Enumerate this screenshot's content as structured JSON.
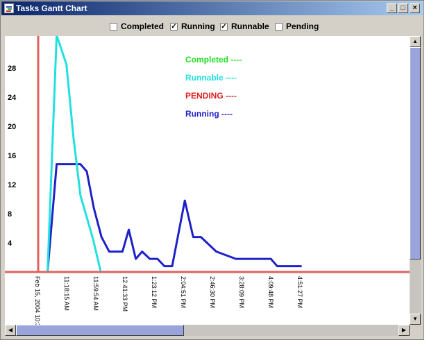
{
  "window": {
    "title": "Tasks Gantt Chart",
    "minimize_glyph": "_",
    "maximize_glyph": "□",
    "close_glyph": "×"
  },
  "legend_bar": {
    "checkboxes": [
      {
        "label": "Completed",
        "checked": false
      },
      {
        "label": "Running",
        "checked": true
      },
      {
        "label": "Runnable",
        "checked": true
      },
      {
        "label": "Pending",
        "checked": false
      }
    ]
  },
  "chart_data": {
    "type": "line",
    "title": "",
    "xlabel": "",
    "ylabel": "",
    "ylim": [
      0,
      32
    ],
    "y_ticks": [
      4,
      8,
      12,
      16,
      20,
      24,
      28
    ],
    "x_tick_labels": [
      "Feb 15, 2004 10:3",
      "11:18:15 AM",
      "11:59:54 AM",
      "12:41:33 PM",
      "1:23:12 PM",
      "2:04:51 PM",
      "2:46:30 PM",
      "3:28:09 PM",
      "4:09:48 PM",
      "4:51:27 PM"
    ],
    "x_tick_minutes": [
      36.6,
      78.25,
      119.9,
      161.55,
      203.2,
      244.85,
      286.5,
      328.15,
      369.8,
      411.45
    ],
    "legend_labels": [
      {
        "text": "Completed ----",
        "color": "#22dd22"
      },
      {
        "text": "Runnable ----",
        "color": "#22e0e0"
      },
      {
        "text": "PENDING ----",
        "color": "#e02020"
      },
      {
        "text": "Running ----",
        "color": "#1e20c8"
      }
    ],
    "pending_marker_minutes": 36.6,
    "series": [
      {
        "name": "Running",
        "color": "#1e20c8",
        "x_minutes": [
          50,
          63,
          97,
          106,
          116,
          127,
          138,
          157,
          166,
          176,
          185,
          196,
          207,
          217,
          228,
          246,
          258,
          269,
          280,
          291,
          319,
          339,
          349,
          369,
          378,
          413
        ],
        "y": [
          0,
          14.8,
          14.8,
          13.8,
          8.8,
          4.8,
          2.8,
          2.8,
          5.8,
          1.8,
          2.8,
          1.8,
          1.8,
          0.8,
          0.8,
          9.8,
          4.8,
          4.8,
          3.8,
          2.8,
          1.8,
          1.8,
          1.8,
          1.8,
          0.8,
          0.8
        ]
      },
      {
        "name": "Runnable",
        "color": "#22e0e0",
        "x_minutes": [
          50,
          63,
          77,
          87,
          97,
          115,
          126,
          413
        ],
        "y": [
          0,
          32.5,
          28.5,
          18.5,
          10.5,
          4.5,
          0,
          0
        ]
      }
    ]
  }
}
